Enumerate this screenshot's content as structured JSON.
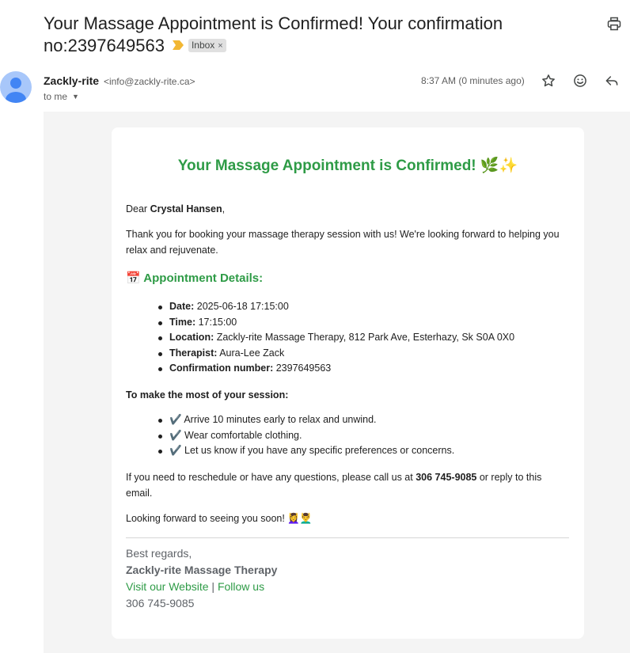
{
  "header": {
    "subject": "Your Massage Appointment is Confirmed! Your confirmation no:2397649563",
    "label": "Inbox",
    "label_remove": "×"
  },
  "sender": {
    "name": "Zackly-rite",
    "email": "<info@zackly-rite.ca>",
    "to": "to me",
    "time": "8:37 AM (0 minutes ago)"
  },
  "colors": {
    "accent_green": "#2e9b46",
    "label_arrow": "#f2b733",
    "avatar": "#a8c7fa"
  },
  "email": {
    "title": "Your Massage Appointment is Confirmed! 🌿✨",
    "greeting_prefix": "Dear ",
    "customer_name": "Crystal Hansen",
    "greeting_suffix": ",",
    "intro": "Thank you for booking your massage therapy session with us! We're looking forward to helping you relax and rejuvenate.",
    "details_heading": "📅 Appointment Details:",
    "details": [
      {
        "label": "Date:",
        "value": " 2025-06-18 17:15:00"
      },
      {
        "label": "Time:",
        "value": " 17:15:00"
      },
      {
        "label": "Location:",
        "value": " Zackly-rite Massage Therapy, 812 Park Ave, Esterhazy, Sk S0A 0X0"
      },
      {
        "label": "Therapist:",
        "value": " Aura-Lee Zack"
      },
      {
        "label": "Confirmation number:",
        "value": " 2397649563"
      }
    ],
    "tips_heading": "To make the most of your session:",
    "tips": [
      "✔️ Arrive 10 minutes early to relax and unwind.",
      "✔️ Wear comfortable clothing.",
      "✔️ Let us know if you have any specific preferences or concerns."
    ],
    "reschedule_prefix": "If you need to reschedule or have any questions, please call us at ",
    "reschedule_phone": "306 745-9085",
    "reschedule_suffix": " or reply to this email.",
    "closing": "Looking forward to seeing you soon! 💆‍♀️💆‍♂️",
    "signature": {
      "regards": "Best regards,",
      "business": "Zackly-rite Massage Therapy",
      "website_link": "Visit our Website",
      "separator": " | ",
      "follow_link": "Follow us",
      "phone": "306 745-9085"
    }
  }
}
